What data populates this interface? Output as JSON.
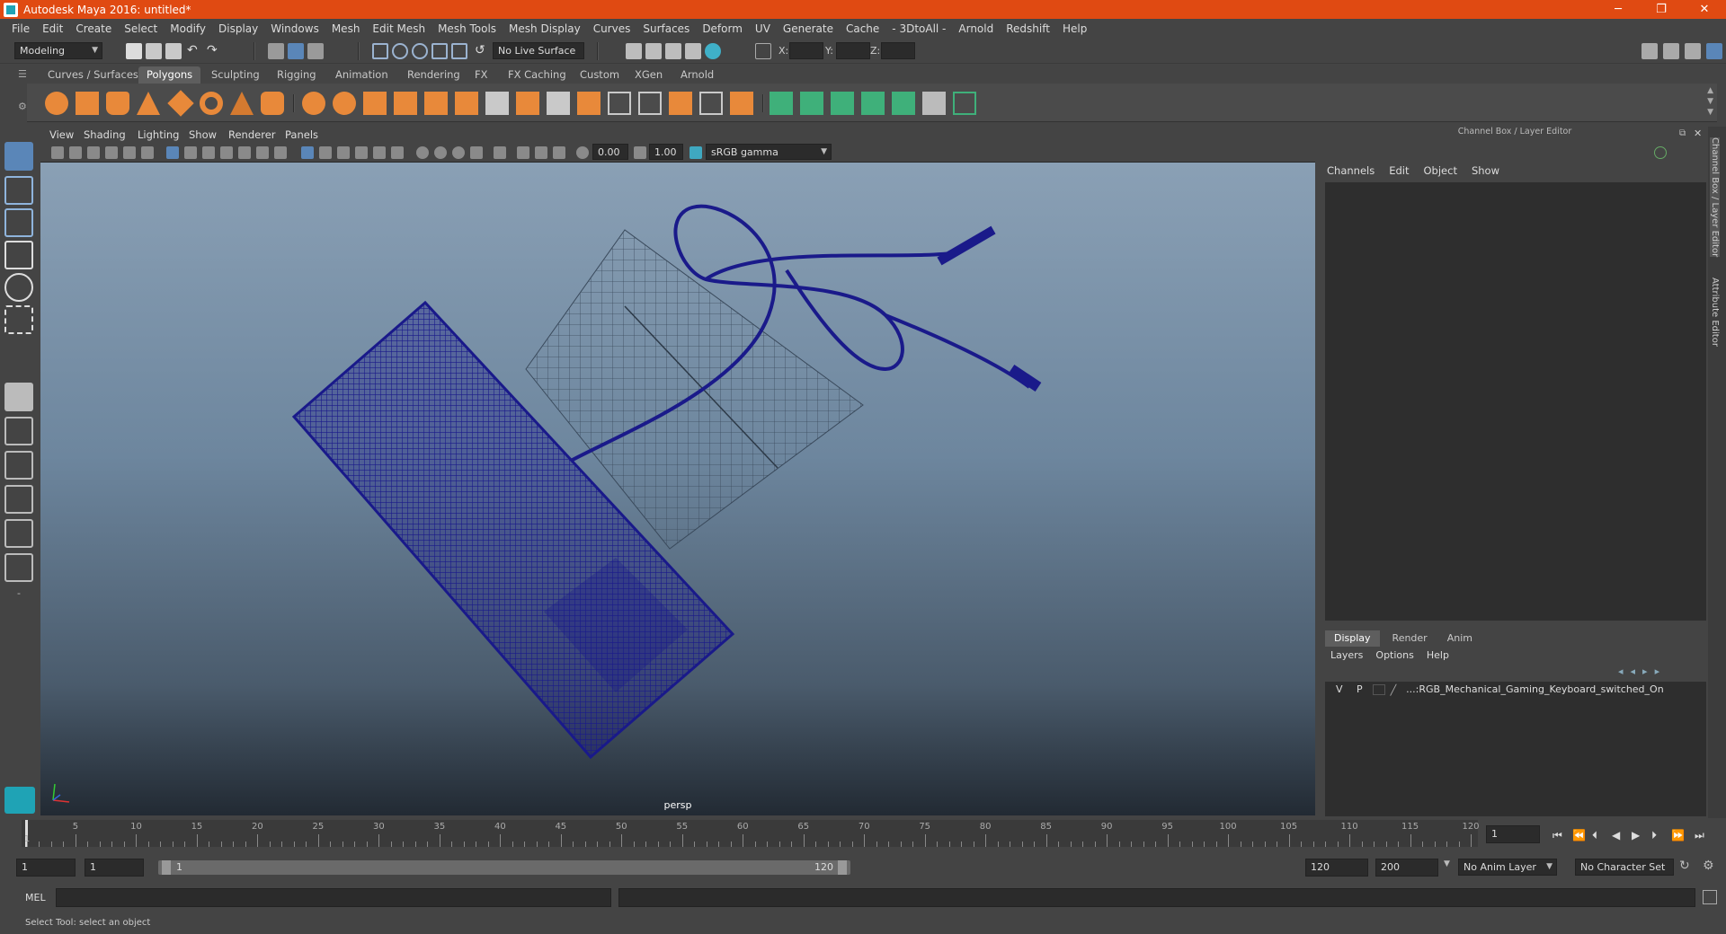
{
  "window": {
    "title": "Autodesk Maya 2016: untitled*",
    "minimize": "─",
    "restore": "❐",
    "close": "✕"
  },
  "menus": [
    "File",
    "Edit",
    "Create",
    "Select",
    "Modify",
    "Display",
    "Windows",
    "Mesh",
    "Edit Mesh",
    "Mesh Tools",
    "Mesh Display",
    "Curves",
    "Surfaces",
    "Deform",
    "UV",
    "Generate",
    "Cache",
    "- 3DtoAll -",
    "Arnold",
    "Redshift",
    "Help"
  ],
  "status_line": {
    "mode": "Modeling",
    "live_surface": "No Live Surface",
    "x_label": "X:",
    "y_label": "Y:",
    "z_label": "Z:"
  },
  "shelf_tabs": [
    "Curves / Surfaces",
    "Polygons",
    "Sculpting",
    "Rigging",
    "Animation",
    "Rendering",
    "FX",
    "FX Caching",
    "Custom",
    "XGen",
    "Arnold"
  ],
  "shelf_active": "Polygons",
  "viewport": {
    "menu": [
      "View",
      "Shading",
      "Lighting",
      "Show",
      "Renderer",
      "Panels"
    ],
    "exposure": "0.00",
    "gamma": "1.00",
    "color_space": "sRGB gamma",
    "camera": "persp",
    "wireframe_color": "#1a1a8a"
  },
  "channel_box": {
    "header": "Channel Box / Layer Editor",
    "menu": [
      "Channels",
      "Edit",
      "Object",
      "Show"
    ]
  },
  "layer_editor": {
    "tabs": [
      "Display",
      "Render",
      "Anim"
    ],
    "active_tab": "Display",
    "menu": [
      "Layers",
      "Options",
      "Help"
    ],
    "layers": [
      {
        "v": "V",
        "p": "P",
        "name": "...:RGB_Mechanical_Gaming_Keyboard_switched_On"
      }
    ]
  },
  "side_tabs": [
    "Channel Box / Layer Editor",
    "Attribute Editor"
  ],
  "timeline": {
    "ticks": [
      5,
      10,
      15,
      20,
      25,
      30,
      35,
      40,
      45,
      50,
      55,
      60,
      65,
      70,
      75,
      80,
      85,
      90,
      95,
      100,
      105,
      110,
      115,
      120
    ],
    "start_label": "1",
    "current_frame": "1"
  },
  "range": {
    "start": "1",
    "anim_start": "1",
    "slider_start": "1",
    "slider_end": "120",
    "anim_end": "120",
    "end": "200",
    "anim_layer": "No Anim Layer",
    "character_set": "No Character Set"
  },
  "command_line": {
    "label": "MEL"
  },
  "help_line": {
    "text": "Select Tool: select an object"
  },
  "accent": {
    "title_bar": "#e04a12",
    "active_tab": "#5e5e5e"
  }
}
